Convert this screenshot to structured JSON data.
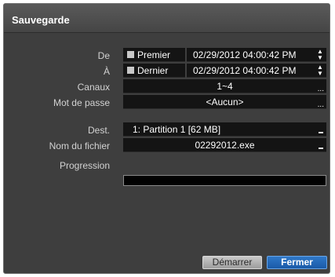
{
  "dialog": {
    "title": "Sauvegarde"
  },
  "form": {
    "from": {
      "label": "De",
      "checkbox_label": "Premier",
      "datetime": "02/29/2012  04:00:42 PM"
    },
    "to": {
      "label": "À",
      "checkbox_label": "Dernier",
      "datetime": "02/29/2012  04:00:42 PM"
    },
    "channels": {
      "label": "Canaux",
      "value": "1~4"
    },
    "password": {
      "label": "Mot de passe",
      "value": "<Aucun>"
    },
    "destination": {
      "label": "Dest.",
      "value": "1: Partition 1 [62 MB]"
    },
    "filename": {
      "label": "Nom du fichier",
      "value": "02292012.exe"
    },
    "progress": {
      "label": "Progression",
      "value": 0
    }
  },
  "buttons": {
    "start": "Démarrer",
    "close": "Fermer"
  },
  "glyphs": {
    "ellipsis": "...",
    "spin_up": "▲",
    "spin_down": "▼"
  },
  "colors": {
    "panel_bg": "#3e3e3e",
    "field_bg": "#141414",
    "accent": "#1f66b8"
  }
}
